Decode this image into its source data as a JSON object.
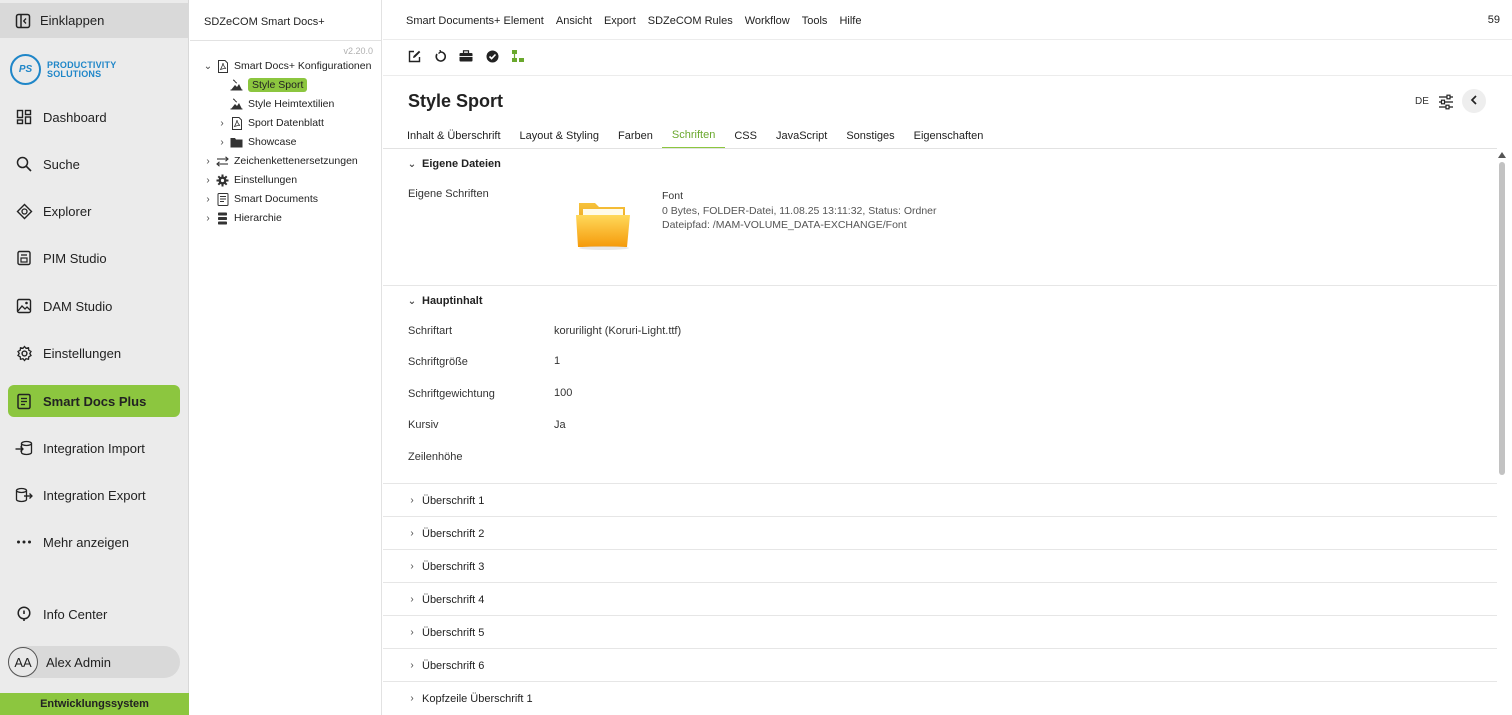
{
  "nav": {
    "collapse_label": "Einklappen",
    "logo_initials": "PS",
    "logo_line1": "PRODUCTIVITY",
    "logo_line2": "SOLUTIONS",
    "items": [
      {
        "label": "Dashboard",
        "icon": "dashboard-icon"
      },
      {
        "label": "Suche",
        "icon": "search-icon"
      },
      {
        "label": "Explorer",
        "icon": "explorer-icon"
      },
      {
        "label": "PIM Studio",
        "icon": "pim-studio-icon"
      },
      {
        "label": "DAM Studio",
        "icon": "image-icon"
      },
      {
        "label": "Einstellungen",
        "icon": "gear-icon"
      },
      {
        "label": "Smart Docs Plus",
        "icon": "document-icon",
        "active": true
      },
      {
        "label": "Integration Import",
        "icon": "import-icon"
      },
      {
        "label": "Integration Export",
        "icon": "export-icon"
      },
      {
        "label": "Mehr anzeigen",
        "icon": "more-icon"
      }
    ],
    "info_center": "Info Center",
    "user_initials": "AA",
    "user_name": "Alex Admin",
    "environment": "Entwicklungssystem",
    "accent_color": "#8cc63f"
  },
  "tree": {
    "title": "SDZeCOM Smart Docs+",
    "version": "v2.20.0",
    "items": [
      {
        "label": "Smart Docs+ Konfigurationen",
        "icon": "pdf-icon",
        "expanded": true
      },
      {
        "label": "Style Sport",
        "icon": "style-icon",
        "selected": true
      },
      {
        "label": "Style Heimtextilien",
        "icon": "style-icon"
      },
      {
        "label": "Sport Datenblatt",
        "icon": "pdf-icon"
      },
      {
        "label": "Showcase",
        "icon": "folder-icon"
      },
      {
        "label": "Zeichenkettenersetzungen",
        "icon": "swap-icon"
      },
      {
        "label": "Einstellungen",
        "icon": "gear-icon"
      },
      {
        "label": "Smart Documents",
        "icon": "document-icon"
      },
      {
        "label": "Hierarchie",
        "icon": "hierarchy-icon"
      }
    ]
  },
  "menubar": {
    "items": [
      "Smart Documents+ Element",
      "Ansicht",
      "Export",
      "SDZeCOM Rules",
      "Workflow",
      "Tools",
      "Hilfe"
    ],
    "count": "59"
  },
  "toolbar": {
    "icons": [
      "edit-icon",
      "refresh-icon",
      "briefcase-icon",
      "check-circle-icon",
      "hierarchy-icon"
    ]
  },
  "page": {
    "title": "Style Sport",
    "language": "DE",
    "tabs": [
      "Inhalt & Überschrift",
      "Layout & Styling",
      "Farben",
      "Schriften",
      "CSS",
      "JavaScript",
      "Sonstiges",
      "Eigenschaften"
    ],
    "active_tab": "Schriften"
  },
  "own_files": {
    "heading": "Eigene Dateien",
    "label": "Eigene Schriften",
    "file_name": "Font",
    "file_meta": "0 Bytes, FOLDER-Datei, 11.08.25 13:11:32, Status: Ordner",
    "file_path": "Dateipfad: /MAM-VOLUME_DATA-EXCHANGE/Font"
  },
  "main_content": {
    "heading": "Hauptinhalt",
    "fields": [
      {
        "label": "Schriftart",
        "value": "korurilight (Koruri-Light.ttf)"
      },
      {
        "label": "Schriftgröße",
        "value": "1"
      },
      {
        "label": "Schriftgewichtung",
        "value": "100"
      },
      {
        "label": "Kursiv",
        "value": "Ja"
      },
      {
        "label": "Zeilenhöhe",
        "value": ""
      }
    ]
  },
  "accordions": [
    "Überschrift 1",
    "Überschrift 2",
    "Überschrift 3",
    "Überschrift 4",
    "Überschrift 5",
    "Überschrift 6",
    "Kopfzeile Überschrift 1"
  ]
}
